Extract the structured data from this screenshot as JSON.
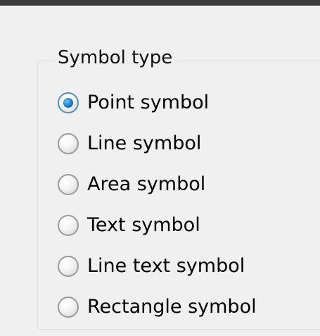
{
  "symbol_type_group": {
    "title": "Symbol type",
    "options": [
      {
        "label": "Point symbol",
        "checked": true
      },
      {
        "label": "Line symbol",
        "checked": false
      },
      {
        "label": "Area symbol",
        "checked": false
      },
      {
        "label": "Text symbol",
        "checked": false
      },
      {
        "label": "Line text symbol",
        "checked": false
      },
      {
        "label": "Rectangle symbol",
        "checked": false
      }
    ]
  },
  "colors": {
    "background": "#f0f0f0",
    "selected_radio": "#1a79c4"
  }
}
